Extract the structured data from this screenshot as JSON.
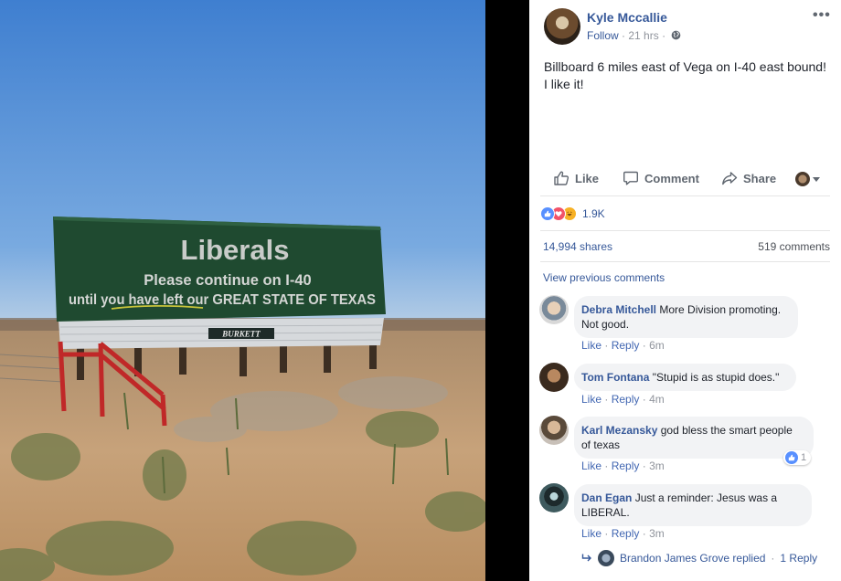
{
  "photo": {
    "billboard_title": "Liberals",
    "billboard_line1": "Please continue on I-40",
    "billboard_line2": "until you have left our GREAT STATE OF TEXAS",
    "billboard_brand": "BURKETT"
  },
  "post": {
    "author": "Kyle Mccallie",
    "follow_label": "Follow",
    "time": "21 hrs",
    "dot": "·",
    "more_icon": "•••",
    "text": "Billboard 6 miles east of Vega on I-40 east bound! I like it!"
  },
  "actions": {
    "like_label": "Like",
    "comment_label": "Comment",
    "share_label": "Share"
  },
  "stats": {
    "reactions_count": "1.9K",
    "shares": "14,994 shares",
    "comments": "519 comments",
    "view_previous": "View previous comments"
  },
  "comment_actions": {
    "like": "Like",
    "reply": "Reply",
    "dot": "·"
  },
  "comments": [
    {
      "name": "Debra Mitchell",
      "text": "More Division promoting. Not good.",
      "time": "6m"
    },
    {
      "name": "Tom Fontana",
      "text": "\"Stupid is as stupid does.\"",
      "time": "4m"
    },
    {
      "name": "Karl Mezansky",
      "text": "god bless the smart people of texas",
      "time": "3m",
      "likes": "1"
    },
    {
      "name": "Dan Egan",
      "text": "Just a reminder: Jesus was a LIBERAL.",
      "time": "3m"
    }
  ],
  "reply_summary": {
    "text": "Brandon James Grove replied",
    "sep": "·",
    "link": "1 Reply"
  },
  "colors": {
    "link_blue": "#365899",
    "sky": "#4f88d0",
    "billboard_green": "#1f4a30",
    "bubble_gray": "#f2f3f5"
  }
}
